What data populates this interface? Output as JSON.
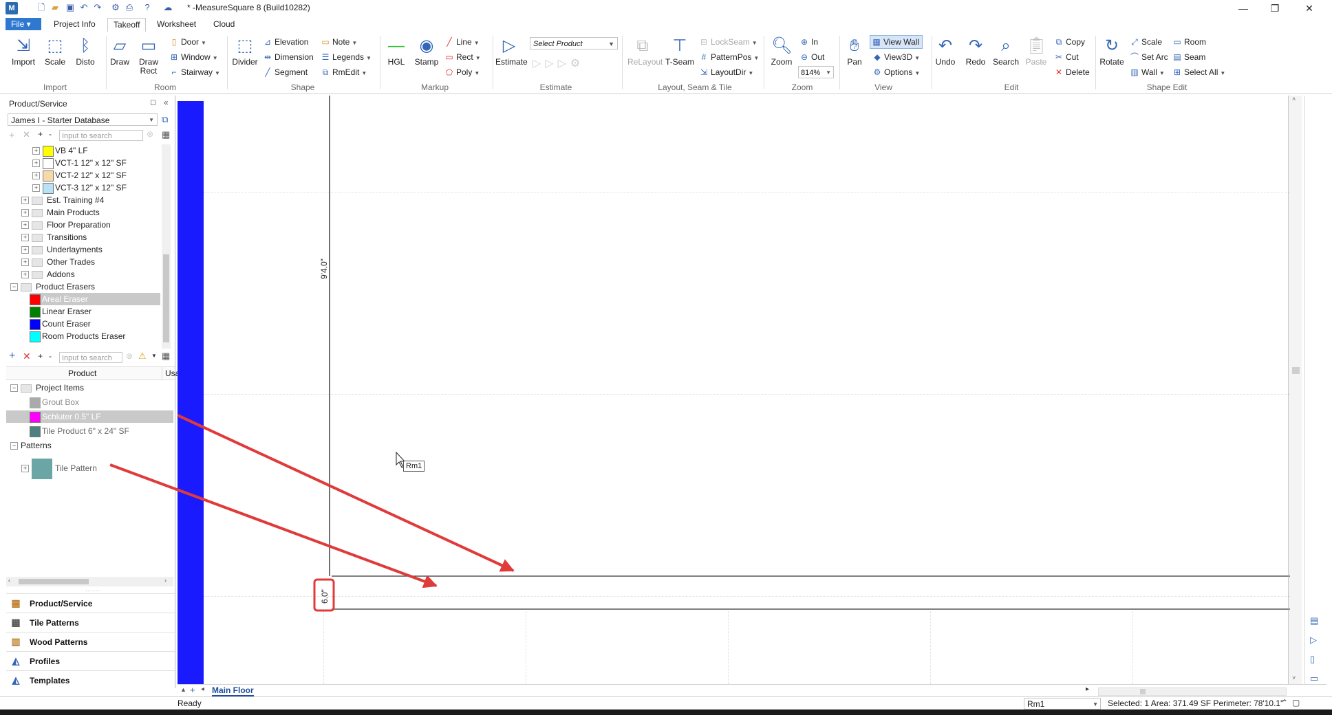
{
  "window": {
    "title": "* -MeasureSquare 8 (Build10282)",
    "app_icon": "M",
    "minimize": "—",
    "restore": "❐",
    "close": "✕"
  },
  "menu": {
    "file": "File",
    "tabs": [
      "Project Info",
      "Takeoff",
      "Worksheet",
      "Cloud"
    ],
    "active_tab": "Takeoff"
  },
  "ribbon": {
    "import": {
      "group": "Import",
      "import": "Import",
      "scale": "Scale",
      "disto": "Disto"
    },
    "room": {
      "group": "Room",
      "draw": "Draw",
      "draw_rect": "Draw Rect",
      "door": "Door",
      "window": "Window",
      "stairway": "Stairway"
    },
    "shape": {
      "group": "Shape",
      "divider": "Divider",
      "elevation": "Elevation",
      "dimension": "Dimension",
      "segment": "Segment",
      "note": "Note",
      "legends": "Legends",
      "rmedit": "RmEdit"
    },
    "markup": {
      "group": "Markup",
      "hgl": "HGL",
      "stamp": "Stamp",
      "line": "Line",
      "rect": "Rect",
      "poly": "Poly"
    },
    "estimate": {
      "group": "Estimate",
      "estimate": "Estimate",
      "select_product_placeholder": "Select Product"
    },
    "layout": {
      "group": "Layout, Seam & Tile",
      "relayout": "ReLayout",
      "tseam": "T-Seam",
      "lockseam": "LockSeam",
      "patternpos": "PatternPos",
      "layoutdir": "LayoutDir"
    },
    "zoom": {
      "group": "Zoom",
      "zoom": "Zoom",
      "in": "In",
      "out": "Out",
      "level": "814%"
    },
    "view": {
      "group": "View",
      "pan": "Pan",
      "view_wall": "View Wall",
      "view3d": "View3D",
      "options": "Options"
    },
    "edit": {
      "group": "Edit",
      "undo": "Undo",
      "redo": "Redo",
      "search": "Search",
      "paste": "Paste",
      "copy": "Copy",
      "cut": "Cut",
      "delete": "Delete"
    },
    "shape_edit": {
      "group": "Shape Edit",
      "rotate": "Rotate",
      "scale": "Scale",
      "set_arc": "Set Arc",
      "wall": "Wall",
      "room": "Room",
      "seam": "Seam",
      "select_all": "Select All"
    }
  },
  "left_panel": {
    "title": "Product/Service",
    "database": "James I - Starter Database",
    "search_placeholder": "Input to search",
    "tree": [
      {
        "label": "VB 4\" LF",
        "color": "#ffff00",
        "level": 2,
        "expander": "+"
      },
      {
        "label": "VCT-1 12\" x 12\" SF",
        "color": "#ffffff",
        "level": 2,
        "expander": "+"
      },
      {
        "label": "VCT-2 12\" x 12\" SF",
        "color": "#f7d9a8",
        "level": 2,
        "expander": "+"
      },
      {
        "label": "VCT-3 12\" x 12\" SF",
        "color": "#b7e3f5",
        "level": 2,
        "expander": "+"
      },
      {
        "label": "Est. Training #4",
        "level": 1,
        "expander": "+"
      },
      {
        "label": "Main Products",
        "level": 1,
        "expander": "+"
      },
      {
        "label": "Floor Preparation",
        "level": 1,
        "expander": "+"
      },
      {
        "label": "Transitions",
        "level": 1,
        "expander": "+"
      },
      {
        "label": "Underlayments",
        "level": 1,
        "expander": "+"
      },
      {
        "label": "Other Trades",
        "level": 1,
        "expander": "+"
      },
      {
        "label": "Addons",
        "level": 1,
        "expander": "+"
      },
      {
        "label": "Product Erasers",
        "level": 0,
        "expander": "−"
      },
      {
        "label": "Areal Eraser",
        "color": "#ff0000",
        "level": 3,
        "selected": true
      },
      {
        "label": "Linear Eraser",
        "color": "#008000",
        "level": 3
      },
      {
        "label": "Count Eraser",
        "color": "#0000ff",
        "level": 3
      },
      {
        "label": "Room Products Eraser",
        "color": "#00ffff",
        "level": 3
      }
    ],
    "items_header": {
      "product": "Product",
      "usage": "Usa"
    },
    "items": [
      {
        "label": "Project Items",
        "type": "folder",
        "expander": "−"
      },
      {
        "label": "Grout Box",
        "color": "#aaaaaa",
        "type": "item"
      },
      {
        "label": "Schluter 0.5\" LF",
        "color": "#ff00ff",
        "type": "item",
        "selected": true
      },
      {
        "label": "Tile Product 6\" x 24\" SF",
        "color": "#4d8080",
        "type": "item"
      },
      {
        "label": "Patterns",
        "type": "folder",
        "expander": "−"
      },
      {
        "label": "Tile Pattern",
        "color": "#6aa6a6",
        "type": "pattern",
        "expander": "+"
      }
    ],
    "nav": [
      "Product/Service",
      "Tile Patterns",
      "Wood Patterns",
      "Profiles",
      "Templates"
    ]
  },
  "canvas": {
    "dim_vertical": "9'4.0\"",
    "dim_small": "6.0\"",
    "room_label": "Rm1"
  },
  "sheet_tabs": {
    "active": "Main Floor",
    "add": "+"
  },
  "status": {
    "ready": "Ready",
    "room_select": "Rm1",
    "selection": "Selected: 1 Area: 371.49 SF Perimeter: 78'10.1\""
  },
  "colors": {
    "accent": "#2f78d0",
    "annotation": "#e03a3a",
    "room_fill": "#1a1aff"
  }
}
